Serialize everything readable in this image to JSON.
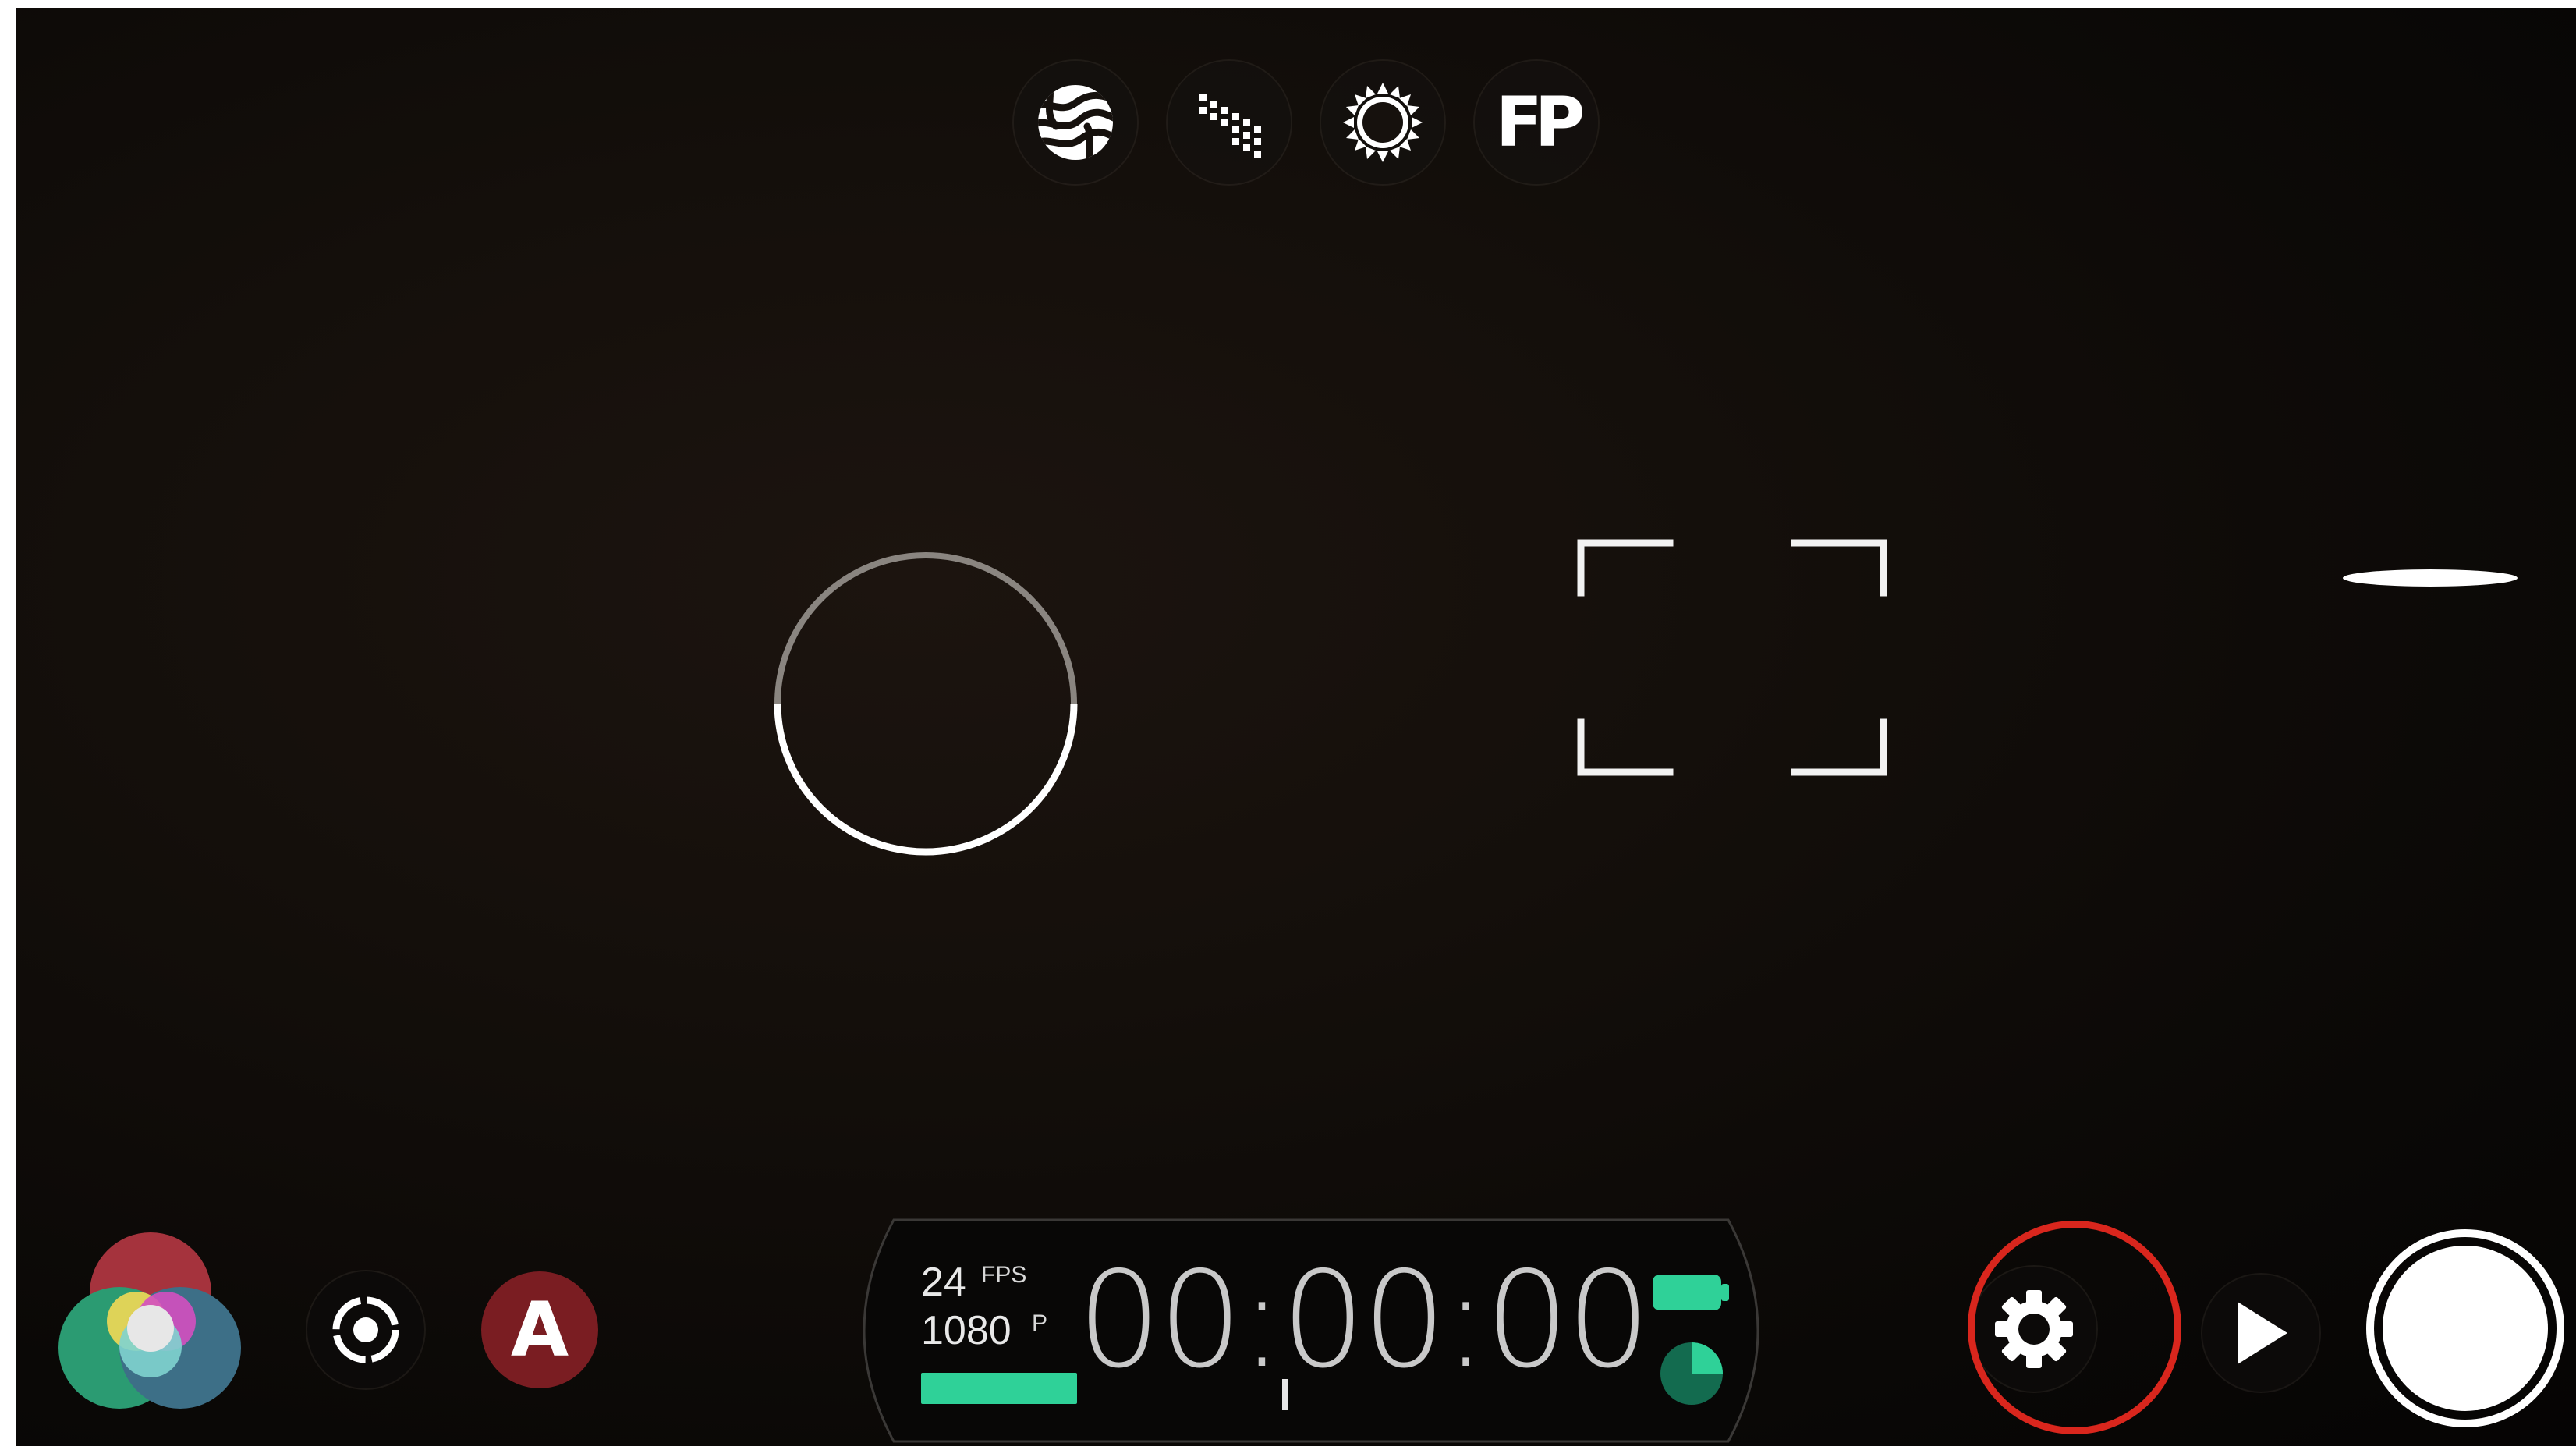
{
  "top_tools": {
    "zebra_icon": "zebra-stripes-icon",
    "peaking_icon": "focus-peaking-icon",
    "exposure_icon": "exposure-sun-icon",
    "false_color_label": "FP"
  },
  "reticle": {
    "focus_icon": "focus-ring-icon",
    "frame_icon": "frame-guide-brackets",
    "level_icon": "horizon-level-indicator"
  },
  "bottom_left": {
    "color_icon": "color-wheels-icon",
    "stabilizer_icon": "stabilization-icon",
    "auto_label": "A"
  },
  "status": {
    "fps_value": "24",
    "fps_unit": "FPS",
    "resolution_value": "1080",
    "resolution_unit": "P",
    "timecode": "00:00:00",
    "audio_level": 0.2,
    "battery_icon": "battery-icon",
    "storage_icon": "storage-pie-icon"
  },
  "bottom_right": {
    "settings_icon": "gear-icon",
    "play_icon": "play-icon",
    "record_icon": "record-shutter-icon",
    "highlight_color": "#d9261d"
  },
  "colors": {
    "accent_green": "#2fd198",
    "auto_red": "#7a1d22",
    "background": "#0a0806"
  }
}
